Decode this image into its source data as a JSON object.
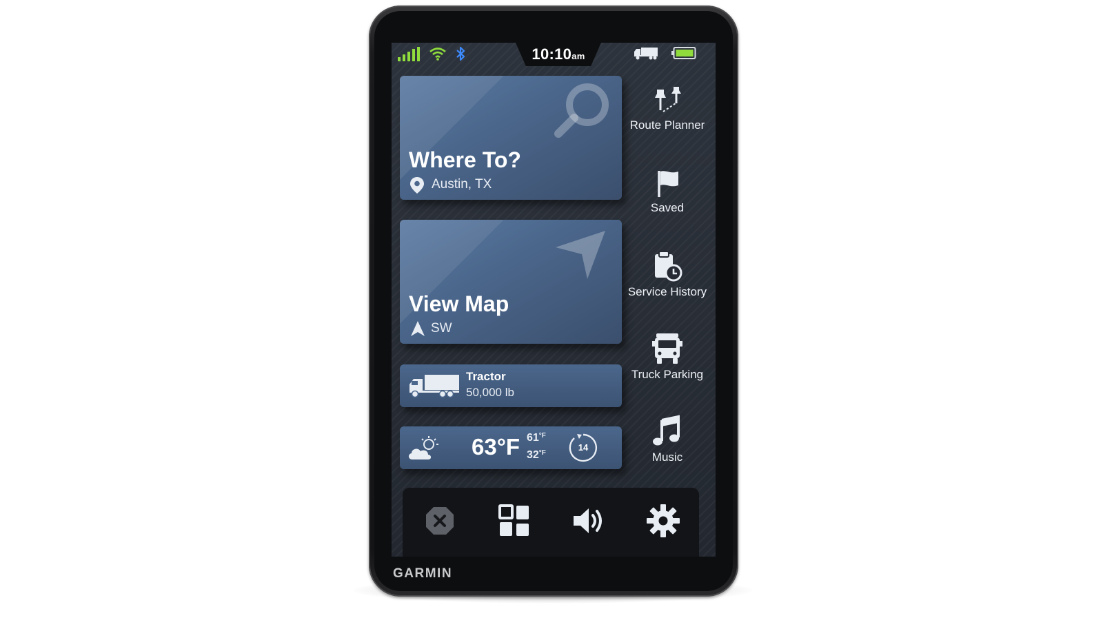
{
  "device": {
    "brand": "GARMIN"
  },
  "status_bar": {
    "time": "10:10",
    "ampm": "am",
    "icons": [
      "signal-icon",
      "wifi-icon",
      "bluetooth-icon",
      "truck-profile-icon",
      "battery-icon"
    ]
  },
  "tiles": {
    "where_to": {
      "title": "Where To?",
      "location": "Austin, TX",
      "icon": "search-icon"
    },
    "view_map": {
      "title": "View Map",
      "heading": "SW",
      "icon": "navigation-arrow-icon"
    },
    "vehicle": {
      "name": "Tractor",
      "weight": "50,000 lb",
      "icon": "truck-icon"
    },
    "weather": {
      "temperature": "63°F",
      "high": "61",
      "low": "32",
      "unit": "F",
      "forecast_days": "14",
      "icon": "partly-cloudy-icon"
    }
  },
  "side_menu": [
    {
      "label": "Route Planner",
      "icon": "route-pins-icon"
    },
    {
      "label": "Saved",
      "icon": "flag-icon"
    },
    {
      "label": "Service History",
      "icon": "clipboard-clock-icon"
    },
    {
      "label": "Truck Parking",
      "icon": "truck-front-icon"
    },
    {
      "label": "Music",
      "icon": "music-note-icon"
    }
  ],
  "bottom_bar": [
    {
      "icon": "stop-icon"
    },
    {
      "icon": "apps-grid-icon"
    },
    {
      "icon": "volume-icon"
    },
    {
      "icon": "settings-gear-icon"
    }
  ],
  "colors": {
    "signal": "#8fdc3c",
    "bluetooth": "#3d8bff",
    "battery": "#8fdc3c",
    "tile": "#4b678c",
    "screen_bg": "#262b33"
  }
}
